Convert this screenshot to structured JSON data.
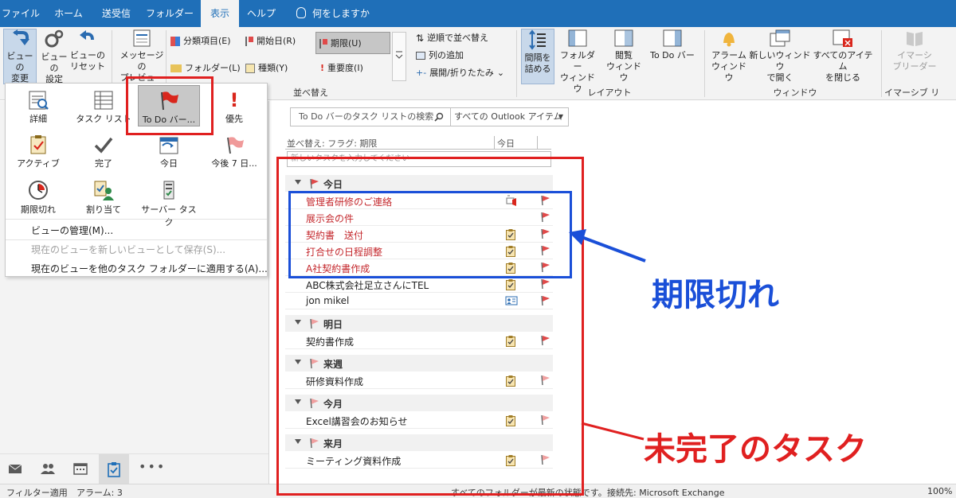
{
  "ribbon_tabs": [
    "ファイル",
    "ホーム",
    "送受信",
    "フォルダー",
    "表示",
    "ヘルプ"
  ],
  "active_tab": "表示",
  "tell_me": "何をしますか",
  "ribbon": {
    "change_view": "ビューの\n変更",
    "view_settings": "ビューの\n設定",
    "reset_view": "ビューの\nリセット",
    "message_preview": "メッセージの\nプレビュー",
    "arrangement": {
      "categories": "分類項目(E)",
      "start_date": "開始日(R)",
      "due_date": "期限(U)",
      "folder": "フォルダー(L)",
      "type": "種類(Y)",
      "importance": "重要度(I)",
      "reverse_sort": "逆順で並べ替え",
      "add_columns": "列の追加",
      "expand_collapse": "展開/折りたたみ",
      "group_label": "並べ替え"
    },
    "layout": {
      "spacing": "間隔を\n詰める",
      "folder_pane": "フォルダー\nウィンドウ",
      "reading_pane": "閲覧\nウィンドウ",
      "todo_bar": "To Do バー",
      "group_label": "レイアウト"
    },
    "window": {
      "reminders": "アラーム\nウィンドウ",
      "open_new_window": "新しいウィンドウ\nで開く",
      "close_all": "すべてのアイテム\nを閉じる",
      "group_label": "ウィンドウ"
    },
    "immersive": {
      "reader": "イマーシ\nブリーダー",
      "group_label": "イマーシブ リ"
    }
  },
  "view_menu": {
    "items": [
      {
        "label": "詳細",
        "icon": "detail-view-icon",
        "selected": false
      },
      {
        "label": "タスク リスト",
        "icon": "task-list-icon",
        "selected": false
      },
      {
        "label": "To Do バー...",
        "icon": "red-flag-icon",
        "selected": true
      },
      {
        "label": "優先",
        "icon": "priority-icon",
        "selected": false
      },
      {
        "label": "アクティブ",
        "icon": "active-icon",
        "selected": false
      },
      {
        "label": "完了",
        "icon": "checkmark-icon",
        "selected": false
      },
      {
        "label": "今日",
        "icon": "today-icon",
        "selected": false
      },
      {
        "label": "今後 7 日...",
        "icon": "next-7-days-icon",
        "selected": false
      },
      {
        "label": "期限切れ",
        "icon": "overdue-clock-icon",
        "selected": false
      },
      {
        "label": "割り当て",
        "icon": "assigned-icon",
        "selected": false
      },
      {
        "label": "サーバー タスク",
        "icon": "server-tasks-icon",
        "selected": false
      }
    ],
    "manage_views": "ビューの管理(M)...",
    "save_as_new": "現在のビューを新しいビューとして保存(S)...",
    "apply_to_other": "現在のビューを他のタスク フォルダーに適用する(A)..."
  },
  "todo": {
    "search_placeholder": "To Do バーのタスク リストの検索",
    "scope": "すべての Outlook アイテム",
    "sort_label": "並べ替え: フラグ: 期限",
    "sort_value": "今日",
    "new_task_placeholder": "新しいタスクを入力してください",
    "groups": [
      {
        "label": "今日",
        "tasks": [
          {
            "subject": "管理者研修のご連絡",
            "overdue": true,
            "type": "mail"
          },
          {
            "subject": "展示会の件",
            "overdue": true,
            "type": "none"
          },
          {
            "subject": "契約書　送付",
            "overdue": true,
            "type": "task"
          },
          {
            "subject": "打合せの日程調整",
            "overdue": true,
            "type": "task"
          },
          {
            "subject": "A社契約書作成",
            "overdue": true,
            "type": "task"
          },
          {
            "subject": "ABC株式会社足立さんにTEL",
            "overdue": false,
            "type": "task"
          },
          {
            "subject": "jon mikel",
            "overdue": false,
            "type": "contact"
          }
        ]
      },
      {
        "label": "明日",
        "tasks": [
          {
            "subject": "契約書作成",
            "overdue": false,
            "type": "task"
          }
        ]
      },
      {
        "label": "来週",
        "tasks": [
          {
            "subject": "研修資料作成",
            "overdue": false,
            "type": "task"
          }
        ]
      },
      {
        "label": "今月",
        "tasks": [
          {
            "subject": "Excel講習会のお知らせ",
            "overdue": false,
            "type": "task"
          }
        ]
      },
      {
        "label": "来月",
        "tasks": [
          {
            "subject": "ミーティング資料作成",
            "overdue": false,
            "type": "task"
          }
        ]
      }
    ]
  },
  "annotations": {
    "overdue_label": "期限切れ",
    "incomplete_label": "未完了のタスク",
    "blue": "#1a4fd8",
    "red": "#e02020"
  },
  "status": {
    "filter": "フィルター適用",
    "alarms": "アラーム: 3",
    "folders_status": "すべてのフォルダーが最新の状態です。",
    "connection": "接続先: Microsoft Exchange",
    "zoom": "100%"
  },
  "colors": {
    "accent": "#1f6fb8",
    "overdue_text": "#c4282d",
    "flag": "#e04a4a",
    "flag_light": "#f0a0a0"
  }
}
